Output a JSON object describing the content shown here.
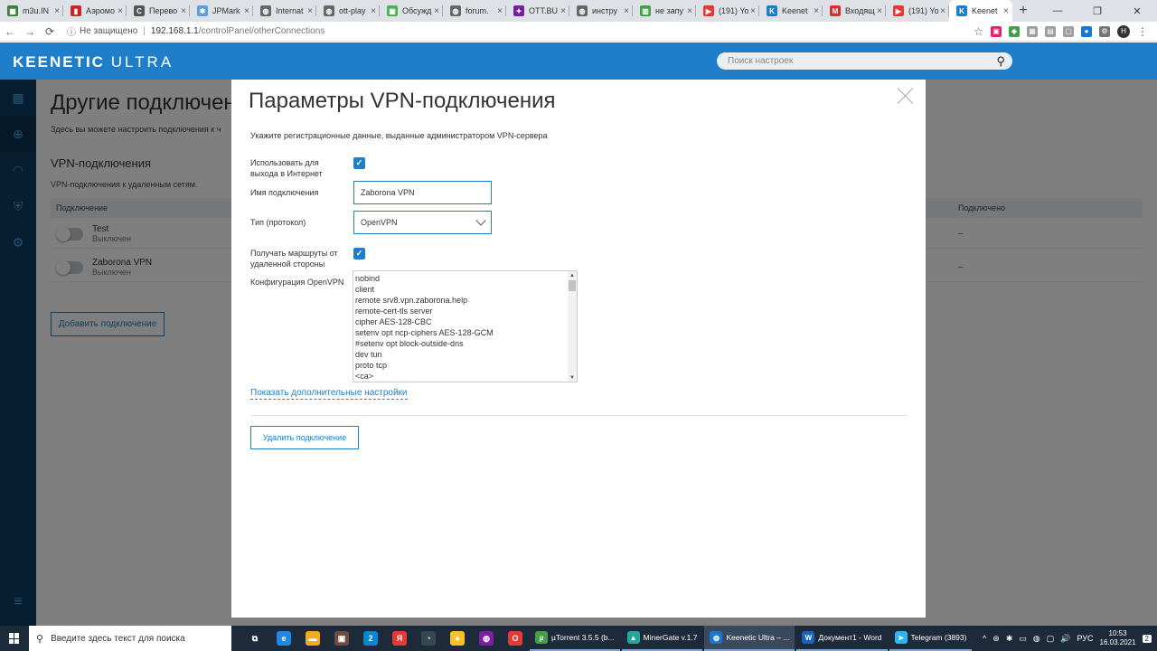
{
  "browser": {
    "tabs": [
      {
        "label": "m3u.IN",
        "color": "#3c7d3c",
        "glyph": "▦",
        "active": false
      },
      {
        "label": "Аэромо",
        "color": "#c62828",
        "glyph": "▮",
        "active": false
      },
      {
        "label": "Перево",
        "color": "#555555",
        "glyph": "C",
        "active": false
      },
      {
        "label": "JPMark",
        "color": "#5aa0e0",
        "glyph": "✱",
        "active": false
      },
      {
        "label": "Internat",
        "color": "#666666",
        "glyph": "◍",
        "active": false
      },
      {
        "label": "ott-play",
        "color": "#666666",
        "glyph": "◍",
        "active": false
      },
      {
        "label": "Обсужд",
        "color": "#4caf50",
        "glyph": "▣",
        "active": false
      },
      {
        "label": "forum.",
        "color": "#666666",
        "glyph": "◍",
        "active": false
      },
      {
        "label": "OTT.BU",
        "color": "#7b1fa2",
        "glyph": "✦",
        "active": false
      },
      {
        "label": "инстру",
        "color": "#666666",
        "glyph": "◍",
        "active": false
      },
      {
        "label": "не запу",
        "color": "#43a047",
        "glyph": "▥",
        "active": false
      },
      {
        "label": "(191) Yo",
        "color": "#e53935",
        "glyph": "▶",
        "active": false
      },
      {
        "label": "Keenet",
        "color": "#1f7ec9",
        "glyph": "K",
        "active": false
      },
      {
        "label": "Входящ",
        "color": "#d32f2f",
        "glyph": "M",
        "active": false
      },
      {
        "label": "(191) Yo",
        "color": "#e53935",
        "glyph": "▶",
        "active": false
      },
      {
        "label": "Keenet",
        "color": "#1f7ec9",
        "glyph": "K",
        "active": true
      }
    ],
    "close_glyph": "×",
    "new_tab": "+",
    "window_controls": [
      "—",
      "❐",
      "✕"
    ],
    "nav": {
      "back": "←",
      "forward": "→",
      "reload": "⟳"
    },
    "security_label": "Не защищено",
    "url_host": "192.168.1.1",
    "url_path": "/controlPanel/otherConnections",
    "star": "☆",
    "extensions": [
      {
        "name": "ext-pink",
        "color": "#e91e63",
        "glyph": "▣"
      },
      {
        "name": "ext-shield",
        "color": "#43a047",
        "glyph": "◆"
      },
      {
        "name": "ext-grid",
        "color": "#9e9e9e",
        "glyph": "▦"
      },
      {
        "name": "ext-doc",
        "color": "#9e9e9e",
        "glyph": "▤"
      },
      {
        "name": "ext-page",
        "color": "#9e9e9e",
        "glyph": "▢"
      },
      {
        "name": "ext-blue-circle",
        "color": "#1976d2",
        "glyph": "●"
      },
      {
        "name": "ext-gear",
        "color": "#757575",
        "glyph": "⚙"
      }
    ],
    "profile_initial": "Н",
    "menu": "⋮"
  },
  "header": {
    "logo_bold": "KEENETIC",
    "logo_thin": "ULTRA",
    "search_placeholder": "Поиск настроек",
    "search_icon": "⚲"
  },
  "sidebar": {
    "items": [
      {
        "name": "dashboard-icon",
        "glyph": "▦",
        "active": false
      },
      {
        "name": "globe-icon",
        "glyph": "⊕",
        "active": true
      },
      {
        "name": "wifi-icon",
        "glyph": "◠",
        "active": false
      },
      {
        "name": "shield-icon",
        "glyph": "⛨",
        "active": false
      },
      {
        "name": "gear-icon",
        "glyph": "⚙",
        "active": false
      }
    ],
    "menu_glyph": "≡"
  },
  "background_page": {
    "title": "Другие подключения",
    "description": "Здесь вы можете настроить подключения к ч",
    "section_title": "VPN-подключения",
    "section_sub": "VPN-подключения к удаленным сетям.",
    "col_connection": "Подключение",
    "col_connected": "Подключено",
    "rows": [
      {
        "name": "Test",
        "status": "Выключен",
        "connected": "–"
      },
      {
        "name": "Zaborona VPN",
        "status": "Выключен",
        "connected": "–"
      }
    ],
    "add_button": "Добавить подключение"
  },
  "modal": {
    "title": "Параметры VPN-подключения",
    "description": "Укажите регистрационные данные, выданные администратором VPN-сервера",
    "use_for_internet_label": "Использовать для выхода в Интернет",
    "use_for_internet_checked": true,
    "connection_name_label": "Имя подключения",
    "connection_name_value": "Zaborona VPN",
    "protocol_label": "Тип (протокол)",
    "protocol_value": "OpenVPN",
    "receive_routes_label": "Получать маршруты от удаленной стороны",
    "receive_routes_checked": true,
    "config_label": "Конфигурация OpenVPN",
    "config_lines": [
      "nobind",
      "client",
      "remote srv8.vpn.zaborona.help",
      "remote-cert-tls server",
      "cipher AES-128-CBC",
      "setenv opt ncp-ciphers AES-128-GCM",
      "#setenv opt block-outside-dns",
      "dev tun",
      "proto tcp",
      "<ca>"
    ],
    "more_settings_link": "Показать дополнительные настройки",
    "delete_button": "Удалить подключение",
    "check_glyph": "✓"
  },
  "taskbar": {
    "search_placeholder": "Введите здесь текст для поиска",
    "search_icon": "⚲",
    "pinned": [
      {
        "name": "task-view-icon",
        "color": "#1c2a3a",
        "glyph": "⧉"
      },
      {
        "name": "edge-icon",
        "color": "#1e88e5",
        "glyph": "e"
      },
      {
        "name": "explorer-icon",
        "color": "#f9a825",
        "glyph": "▬"
      },
      {
        "name": "store-icon",
        "color": "#6d4c41",
        "glyph": "▣"
      },
      {
        "name": "skype-icon",
        "color": "#0288d1",
        "glyph": "2"
      },
      {
        "name": "yandex-icon",
        "color": "#e53935",
        "glyph": "Я"
      },
      {
        "name": "speedometer-icon",
        "color": "#37474f",
        "glyph": "◔"
      },
      {
        "name": "yellow-app-icon",
        "color": "#fbc02d",
        "glyph": "●"
      },
      {
        "name": "viber-icon",
        "color": "#7b1fa2",
        "glyph": "◍"
      },
      {
        "name": "opera-icon",
        "color": "#e53935",
        "glyph": "O"
      }
    ],
    "apps": [
      {
        "label": "µTorrent 3.5.5 (b...",
        "color": "#43a047",
        "glyph": "µ",
        "active": false
      },
      {
        "label": "MinerGate v.1.7",
        "color": "#26a69a",
        "glyph": "▲",
        "active": false
      },
      {
        "label": "Keenetic Ultra – ...",
        "color": "#1976d2",
        "glyph": "◍",
        "active": true
      },
      {
        "label": "Документ1 - Word",
        "color": "#1565c0",
        "glyph": "W",
        "active": false
      },
      {
        "label": "Telegram (3893)",
        "color": "#29b6f6",
        "glyph": "➤",
        "active": false
      }
    ],
    "tray_glyphs": [
      "^",
      "⊛",
      "✱",
      "▭",
      "◍",
      "▢",
      "🔊"
    ],
    "language": "РУС",
    "time": "10:53",
    "date": "16.03.2021",
    "notifications": "2"
  }
}
